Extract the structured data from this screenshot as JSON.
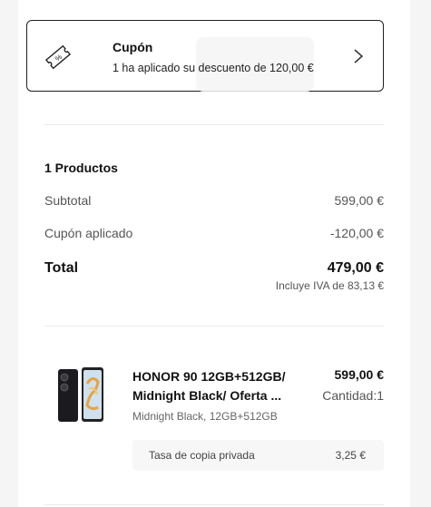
{
  "coupon": {
    "title": "Cupón",
    "description": "1 ha aplicado su descuento de 120,00 €",
    "icon": "coupon-tag-icon",
    "action_icon": "chevron-right-icon"
  },
  "summary": {
    "products_count": "1 Productos",
    "subtotal_label": "Subtotal",
    "subtotal_value": "599,00 €",
    "coupon_label": "Cupón aplicado",
    "coupon_value": "-120,00 €",
    "total_label": "Total",
    "total_value": "479,00 €",
    "vat_note": "Incluye IVA de 83,13 €"
  },
  "product": {
    "name": "HONOR 90 12GB+512GB/ Midnight Black/ Oferta ...",
    "price": "599,00 €",
    "quantity": "Cantidad:1",
    "variant": "Midnight Black, 12GB+512GB",
    "fee_label": "Tasa de copia privada",
    "fee_value": "3,25 €"
  },
  "colors": {
    "border": "#1f1f1f",
    "muted_text": "#555555",
    "background": "#f5f5f5"
  }
}
